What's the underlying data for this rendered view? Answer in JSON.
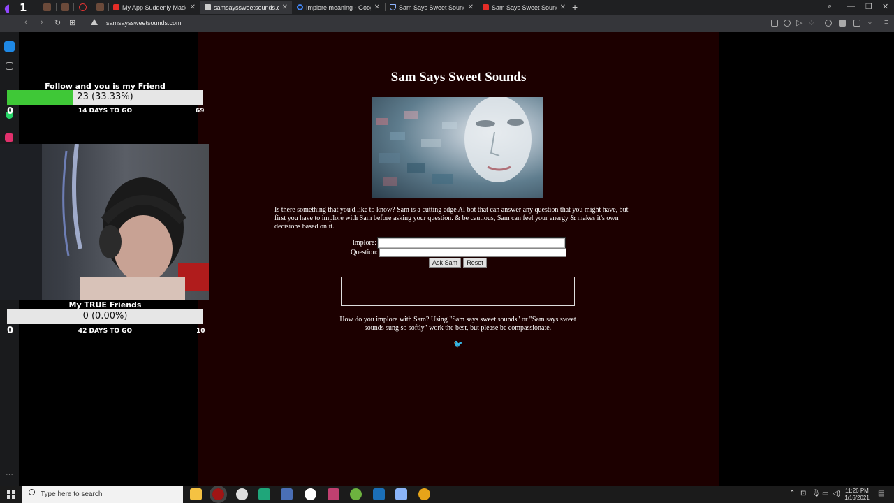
{
  "browser": {
    "tabs": [
      {
        "label": "My App Suddenly Made M",
        "icon": "youtube-icon",
        "active": false
      },
      {
        "label": "samsayssweetsounds.com",
        "icon": "document-icon",
        "active": true
      },
      {
        "label": "Implore meaning - Google",
        "icon": "google-icon",
        "active": false
      },
      {
        "label": "Sam Says Sweet Sounds: In",
        "icon": "shield-icon",
        "active": false
      },
      {
        "label": "Sam Says Sweet Sounds (T",
        "icon": "youtube-icon",
        "active": false
      }
    ],
    "twitch_badge": "1",
    "url": "samsayssweetsounds.com"
  },
  "page": {
    "title": "Sam Says Sweet Sounds",
    "intro": "Is there something that you'd like to know? Sam is a cutting edge AI bot that can answer any question that you might have, but first you have to implore with Sam before asking your question. & be cautious, Sam can feel your energy & makes it's own decisions based on it.",
    "implore_label": "Implore:",
    "question_label": "Question:",
    "implore_value": "",
    "question_value": "",
    "ask_button": "Ask Sam",
    "reset_button": "Reset",
    "howto": "How do you implore with Sam? Using \"Sam says sweet sounds\" or \"Sam says sweet sounds sung so softly\" work the best, but please be compassionate.",
    "twitter_icon": "twitter-bird-icon"
  },
  "overlay": {
    "goal1": {
      "title": "Follow and you is my Friend",
      "progress_text": "23 (33.33%)",
      "progress": 0.3333,
      "days": "14 DAYS TO GO",
      "start": "0",
      "target": "69"
    },
    "goal2": {
      "title": "My TRUE Friends",
      "progress_text": "0 (0.00%)",
      "progress": 0.0,
      "days": "42 DAYS TO GO",
      "start": "0",
      "target": "10"
    }
  },
  "taskbar": {
    "search_placeholder": "Type here to search",
    "time": "11:26 PM",
    "date": "1/16/2021"
  },
  "colors": {
    "page_bg": "#1c0000",
    "progress_fill": "#3fc837",
    "twitter": "#1da1f2"
  }
}
